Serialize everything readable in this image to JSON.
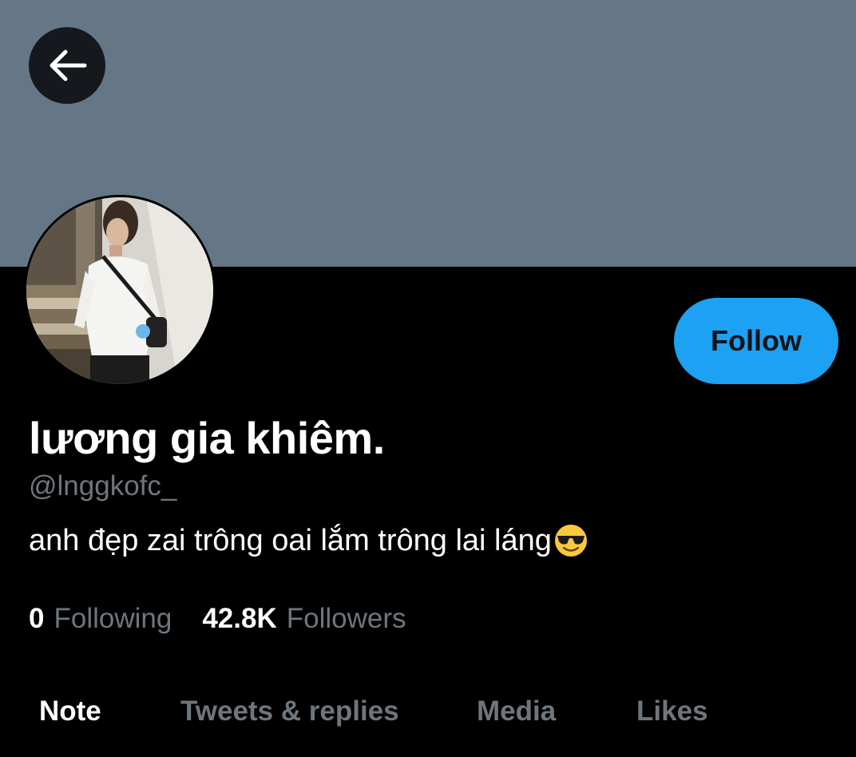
{
  "colors": {
    "banner": "#657786",
    "background": "#000000",
    "accent": "#1da1f2",
    "muted_text": "#6e767d"
  },
  "header": {
    "back_icon": "arrow-left-icon"
  },
  "profile": {
    "display_name": "lương gia khiêm.",
    "handle": "@lnggkofc_",
    "bio": "anh đẹp zai trông oai lắm trông lai láng",
    "bio_emoji": "smiling-face-with-sunglasses-icon",
    "follow_label": "Follow"
  },
  "stats": {
    "following_count": "0",
    "following_label": "Following",
    "followers_count": "42.8K",
    "followers_label": "Followers"
  },
  "tabs": [
    {
      "label": "Note",
      "active": true
    },
    {
      "label": "Tweets & replies",
      "active": false
    },
    {
      "label": "Media",
      "active": false
    },
    {
      "label": "Likes",
      "active": false
    }
  ]
}
